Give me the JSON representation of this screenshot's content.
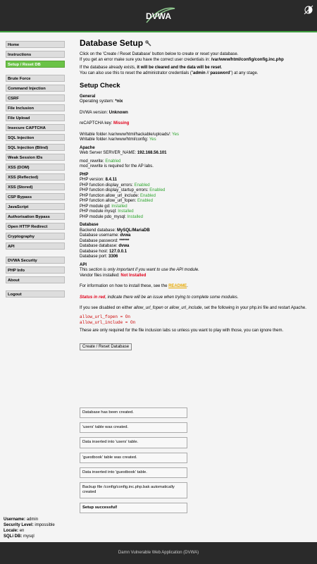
{
  "header": {
    "logo_text": "DVWA"
  },
  "menu": {
    "group1": [
      "Home",
      "Instructions",
      "Setup / Reset DB"
    ],
    "group2": [
      "Brute Force",
      "Command Injection",
      "CSRF",
      "File Inclusion",
      "File Upload",
      "Insecure CAPTCHA",
      "SQL Injection",
      "SQL Injection (Blind)",
      "Weak Session IDs",
      "XSS (DOM)",
      "XSS (Reflected)",
      "XSS (Stored)",
      "CSP Bypass",
      "JavaScript",
      "Authorisation Bypass",
      "Open HTTP Redirect",
      "Cryptography",
      "API"
    ],
    "group3": [
      "DVWA Security",
      "PHP Info",
      "About"
    ],
    "group4": [
      "Logout"
    ]
  },
  "page": {
    "title": "Database Setup",
    "intro1": "Click on the 'Create / Reset Database' button below to create or reset your database.",
    "intro2_prefix": "If you get an error make sure you have the correct user credentials in: ",
    "intro2_path": "/var/www/html/config/config.inc.php",
    "intro3_prefix": "If the database already exists, ",
    "intro3_bold": "it will be cleared and the data will be reset",
    "intro3_suffix": ".",
    "intro4_prefix": "You can also use this to reset the administrator credentials (\"",
    "intro4_admin": "admin",
    "intro4_sep": " // ",
    "intro4_pass": "password",
    "intro4_suffix": "\") at any stage.",
    "check_title": "Setup Check",
    "general_heading": "General",
    "os_label": "Operating system: ",
    "os_value": "*nix",
    "version_label": "DVWA version: ",
    "version_value": "Unknown",
    "recaptcha_label": "reCAPTCHA key: ",
    "recaptcha_value": "Missing",
    "uploads_label": "Writable folder /var/www/html/hackable/uploads/: ",
    "uploads_value": "Yes",
    "config_label": "Writable folder /var/www/html/config: ",
    "config_value": "Yes",
    "apache_heading": "Apache",
    "server_label": "Web Server SERVER_NAME: ",
    "server_value": "192.168.56.101",
    "rewrite_label": "mod_rewrite: ",
    "rewrite_value": "Enabled",
    "rewrite_note": "mod_rewrite is required for the AP labs.",
    "php_heading": "PHP",
    "php_version_label": "PHP version: ",
    "php_version_value": "8.4.11",
    "php_items": [
      {
        "label": "PHP function display_errors: ",
        "value": "Enabled"
      },
      {
        "label": "PHP function display_startup_errors: ",
        "value": "Enabled"
      },
      {
        "label": "PHP function allow_url_include: ",
        "value": "Enabled"
      },
      {
        "label": "PHP function allow_url_fopen: ",
        "value": "Enabled"
      },
      {
        "label": "PHP module gd: ",
        "value": "Installed"
      },
      {
        "label": "PHP module mysql: ",
        "value": "Installed"
      },
      {
        "label": "PHP module pdo_mysql: ",
        "value": "Installed"
      }
    ],
    "db_heading": "Database",
    "db_items": [
      {
        "label": "Backend database: ",
        "value": "MySQL/MariaDB"
      },
      {
        "label": "Database username: ",
        "value": "dvwa"
      },
      {
        "label": "Database password: ",
        "value": "******"
      },
      {
        "label": "Database database: ",
        "value": "dvwa"
      },
      {
        "label": "Database host: ",
        "value": "127.0.0.1"
      },
      {
        "label": "Database port: ",
        "value": "3306"
      }
    ],
    "api_heading": "API",
    "api_note_prefix": "This ",
    "api_note_italic": "section is only important if you want to use the API module.",
    "vendor_label": "Vendor files installed: ",
    "vendor_value": "Not Installed",
    "readme_prefix": "For information on how to install these, see the ",
    "readme_link": "README",
    "readme_suffix": ".",
    "status_red": "Status in red",
    "status_rest": ", indicate there will be an issue when trying to complete some modules.",
    "disabled_p1": "If you see disabled on either ",
    "disabled_fopen": "allow_url_fopen",
    "disabled_or": " or ",
    "disabled_include": "allow_url_include",
    "disabled_p2": ", set the following in your php.ini file and restart Apache.",
    "code1": "allow_url_fopen = On",
    "code2": "allow_url_include = On",
    "only_required": "These are only required for the file inclusion labs so unless you want to play with those, you can ignore them.",
    "button": "Create / Reset Database"
  },
  "messages": [
    "Database has been created.",
    "'users' table was created.",
    "Data inserted into 'users' table.",
    "'guestbook' table was created.",
    "Data inserted into 'guestbook' table.",
    "Backup file /config/config.inc.php.bak automatically created",
    "Setup successful!"
  ],
  "user": {
    "username_label": "Username:",
    "username": "admin",
    "security_label": "Security Level:",
    "security": "impossible",
    "locale_label": "Locale:",
    "locale": "en",
    "sqli_label": "SQLi DB:",
    "sqli": "mysql"
  },
  "footer": "Damn Vulnerable Web Application (DVWA)",
  "colors": {
    "accent_green": "#6ac346",
    "status_green": "#2fa52f",
    "status_red": "#e0001a",
    "link": "#e6a800",
    "header_bg": "#2a2a2a"
  }
}
